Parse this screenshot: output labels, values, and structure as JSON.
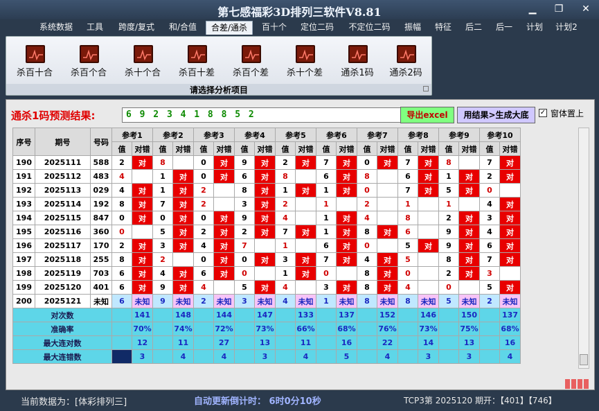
{
  "window": {
    "title": "第七感福彩3D排列三软件V8.81"
  },
  "menu": [
    "系统数据",
    "工具",
    "跨度/复式",
    "和/合值",
    "合差/通杀",
    "百十个",
    "定位二码",
    "不定位二码",
    "振幅",
    "特征",
    "后二",
    "后一",
    "计划",
    "计划2"
  ],
  "ribbon": {
    "buttons": [
      "杀百十合",
      "杀百个合",
      "杀十个合",
      "杀百十差",
      "杀百个差",
      "杀十个差",
      "通杀1码",
      "通杀2码"
    ],
    "caption": "请选择分析项目"
  },
  "prediction": {
    "label": "通杀1码预测结果:",
    "value": "6 9 2 3 4 1 8 8 5 2"
  },
  "actions": {
    "excel": "导出excel",
    "generate": "用结果>生成大底",
    "topmost_check": "✓",
    "topmost": "窗体置上"
  },
  "table": {
    "col_row_index": "序号",
    "col_period": "期号",
    "col_number": "号码",
    "groups": [
      "参考1",
      "参考2",
      "参考3",
      "参考4",
      "参考5",
      "参考6",
      "参考7",
      "参考8",
      "参考9",
      "参考10"
    ],
    "sub_value": "值",
    "sub_result": "对错",
    "rows": [
      {
        "id": "190",
        "period": "2025111",
        "number": "588",
        "cells": [
          [
            "2",
            "对"
          ],
          [
            "8",
            ""
          ],
          [
            "0",
            "对"
          ],
          [
            "9",
            "对"
          ],
          [
            "2",
            "对"
          ],
          [
            "7",
            "对"
          ],
          [
            "0",
            "对"
          ],
          [
            "7",
            "对"
          ],
          [
            "8",
            ""
          ],
          [
            "7",
            "对"
          ]
        ]
      },
      {
        "id": "191",
        "period": "2025112",
        "number": "483",
        "cells": [
          [
            "4",
            ""
          ],
          [
            "1",
            "对"
          ],
          [
            "0",
            "对"
          ],
          [
            "6",
            "对"
          ],
          [
            "8",
            ""
          ],
          [
            "6",
            "对"
          ],
          [
            "8",
            ""
          ],
          [
            "6",
            "对"
          ],
          [
            "1",
            "对"
          ],
          [
            "2",
            "对"
          ]
        ]
      },
      {
        "id": "192",
        "period": "2025113",
        "number": "029",
        "cells": [
          [
            "4",
            "对"
          ],
          [
            "1",
            "对"
          ],
          [
            "2",
            ""
          ],
          [
            "8",
            "对"
          ],
          [
            "1",
            "对"
          ],
          [
            "1",
            "对"
          ],
          [
            "0",
            ""
          ],
          [
            "7",
            "对"
          ],
          [
            "5",
            "对"
          ],
          [
            "0",
            ""
          ]
        ]
      },
      {
        "id": "193",
        "period": "2025114",
        "number": "192",
        "cells": [
          [
            "8",
            "对"
          ],
          [
            "7",
            "对"
          ],
          [
            "2",
            ""
          ],
          [
            "3",
            "对"
          ],
          [
            "2",
            ""
          ],
          [
            "1",
            ""
          ],
          [
            "2",
            ""
          ],
          [
            "1",
            ""
          ],
          [
            "1",
            ""
          ],
          [
            "4",
            "对"
          ]
        ]
      },
      {
        "id": "194",
        "period": "2025115",
        "number": "847",
        "cells": [
          [
            "0",
            "对"
          ],
          [
            "0",
            "对"
          ],
          [
            "0",
            "对"
          ],
          [
            "9",
            "对"
          ],
          [
            "4",
            ""
          ],
          [
            "1",
            "对"
          ],
          [
            "4",
            ""
          ],
          [
            "8",
            ""
          ],
          [
            "2",
            "对"
          ],
          [
            "3",
            "对"
          ]
        ]
      },
      {
        "id": "195",
        "period": "2025116",
        "number": "360",
        "cells": [
          [
            "0",
            ""
          ],
          [
            "5",
            "对"
          ],
          [
            "2",
            "对"
          ],
          [
            "2",
            "对"
          ],
          [
            "7",
            "对"
          ],
          [
            "1",
            "对"
          ],
          [
            "8",
            "对"
          ],
          [
            "6",
            ""
          ],
          [
            "9",
            "对"
          ],
          [
            "4",
            "对"
          ]
        ]
      },
      {
        "id": "196",
        "period": "2025117",
        "number": "170",
        "cells": [
          [
            "2",
            "对"
          ],
          [
            "3",
            "对"
          ],
          [
            "4",
            "对"
          ],
          [
            "7",
            ""
          ],
          [
            "1",
            ""
          ],
          [
            "6",
            "对"
          ],
          [
            "0",
            ""
          ],
          [
            "5",
            "对"
          ],
          [
            "9",
            "对"
          ],
          [
            "6",
            "对"
          ]
        ]
      },
      {
        "id": "197",
        "period": "2025118",
        "number": "255",
        "cells": [
          [
            "8",
            "对"
          ],
          [
            "2",
            ""
          ],
          [
            "0",
            "对"
          ],
          [
            "0",
            "对"
          ],
          [
            "3",
            "对"
          ],
          [
            "7",
            "对"
          ],
          [
            "4",
            "对"
          ],
          [
            "5",
            ""
          ],
          [
            "8",
            "对"
          ],
          [
            "7",
            "对"
          ]
        ]
      },
      {
        "id": "198",
        "period": "2025119",
        "number": "703",
        "cells": [
          [
            "6",
            "对"
          ],
          [
            "4",
            "对"
          ],
          [
            "6",
            "对"
          ],
          [
            "0",
            ""
          ],
          [
            "1",
            "对"
          ],
          [
            "0",
            ""
          ],
          [
            "8",
            "对"
          ],
          [
            "0",
            ""
          ],
          [
            "2",
            "对"
          ],
          [
            "3",
            ""
          ]
        ]
      },
      {
        "id": "199",
        "period": "2025120",
        "number": "401",
        "cells": [
          [
            "6",
            "对"
          ],
          [
            "9",
            "对"
          ],
          [
            "4",
            ""
          ],
          [
            "5",
            "对"
          ],
          [
            "4",
            ""
          ],
          [
            "3",
            "对"
          ],
          [
            "8",
            "对"
          ],
          [
            "4",
            ""
          ],
          [
            "0",
            ""
          ],
          [
            "5",
            "对"
          ]
        ]
      }
    ],
    "pending": {
      "id": "200",
      "period": "2025121",
      "number": "未知",
      "values": [
        "6",
        "9",
        "2",
        "3",
        "4",
        "1",
        "8",
        "8",
        "5",
        "2"
      ],
      "result": "未知"
    },
    "stats": [
      {
        "label": "对次数",
        "values": [
          "141",
          "148",
          "144",
          "147",
          "133",
          "137",
          "152",
          "146",
          "150",
          "137"
        ]
      },
      {
        "label": "准确率",
        "values": [
          "70%",
          "74%",
          "72%",
          "73%",
          "66%",
          "68%",
          "76%",
          "73%",
          "75%",
          "68%"
        ]
      },
      {
        "label": "最大连对数",
        "values": [
          "12",
          "11",
          "27",
          "13",
          "11",
          "16",
          "22",
          "14",
          "13",
          "16"
        ]
      },
      {
        "label": "最大连错数",
        "values": [
          "3",
          "4",
          "4",
          "3",
          "4",
          "5",
          "4",
          "3",
          "3",
          "4"
        ]
      }
    ]
  },
  "status": {
    "data_source": "当前数据为：[体彩排列三]",
    "timer": "自动更新倒计时： 6时0分10秒",
    "period": "TCP3第 2025120 期开：【401】【746】"
  }
}
